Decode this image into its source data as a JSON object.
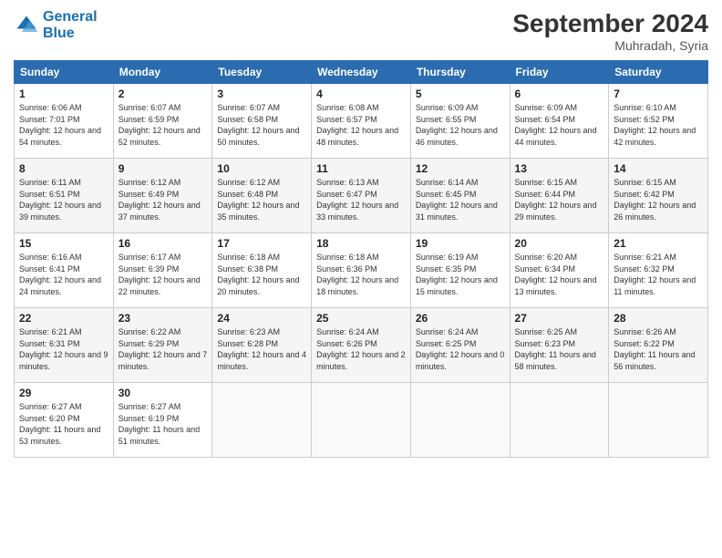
{
  "header": {
    "logo_line1": "General",
    "logo_line2": "Blue",
    "title": "September 2024",
    "subtitle": "Muhradah, Syria"
  },
  "days_of_week": [
    "Sunday",
    "Monday",
    "Tuesday",
    "Wednesday",
    "Thursday",
    "Friday",
    "Saturday"
  ],
  "weeks": [
    [
      {
        "day": "1",
        "sunrise": "6:06 AM",
        "sunset": "7:01 PM",
        "daylight": "12 hours and 54 minutes."
      },
      {
        "day": "2",
        "sunrise": "6:07 AM",
        "sunset": "6:59 PM",
        "daylight": "12 hours and 52 minutes."
      },
      {
        "day": "3",
        "sunrise": "6:07 AM",
        "sunset": "6:58 PM",
        "daylight": "12 hours and 50 minutes."
      },
      {
        "day": "4",
        "sunrise": "6:08 AM",
        "sunset": "6:57 PM",
        "daylight": "12 hours and 48 minutes."
      },
      {
        "day": "5",
        "sunrise": "6:09 AM",
        "sunset": "6:55 PM",
        "daylight": "12 hours and 46 minutes."
      },
      {
        "day": "6",
        "sunrise": "6:09 AM",
        "sunset": "6:54 PM",
        "daylight": "12 hours and 44 minutes."
      },
      {
        "day": "7",
        "sunrise": "6:10 AM",
        "sunset": "6:52 PM",
        "daylight": "12 hours and 42 minutes."
      }
    ],
    [
      {
        "day": "8",
        "sunrise": "6:11 AM",
        "sunset": "6:51 PM",
        "daylight": "12 hours and 39 minutes."
      },
      {
        "day": "9",
        "sunrise": "6:12 AM",
        "sunset": "6:49 PM",
        "daylight": "12 hours and 37 minutes."
      },
      {
        "day": "10",
        "sunrise": "6:12 AM",
        "sunset": "6:48 PM",
        "daylight": "12 hours and 35 minutes."
      },
      {
        "day": "11",
        "sunrise": "6:13 AM",
        "sunset": "6:47 PM",
        "daylight": "12 hours and 33 minutes."
      },
      {
        "day": "12",
        "sunrise": "6:14 AM",
        "sunset": "6:45 PM",
        "daylight": "12 hours and 31 minutes."
      },
      {
        "day": "13",
        "sunrise": "6:15 AM",
        "sunset": "6:44 PM",
        "daylight": "12 hours and 29 minutes."
      },
      {
        "day": "14",
        "sunrise": "6:15 AM",
        "sunset": "6:42 PM",
        "daylight": "12 hours and 26 minutes."
      }
    ],
    [
      {
        "day": "15",
        "sunrise": "6:16 AM",
        "sunset": "6:41 PM",
        "daylight": "12 hours and 24 minutes."
      },
      {
        "day": "16",
        "sunrise": "6:17 AM",
        "sunset": "6:39 PM",
        "daylight": "12 hours and 22 minutes."
      },
      {
        "day": "17",
        "sunrise": "6:18 AM",
        "sunset": "6:38 PM",
        "daylight": "12 hours and 20 minutes."
      },
      {
        "day": "18",
        "sunrise": "6:18 AM",
        "sunset": "6:36 PM",
        "daylight": "12 hours and 18 minutes."
      },
      {
        "day": "19",
        "sunrise": "6:19 AM",
        "sunset": "6:35 PM",
        "daylight": "12 hours and 15 minutes."
      },
      {
        "day": "20",
        "sunrise": "6:20 AM",
        "sunset": "6:34 PM",
        "daylight": "12 hours and 13 minutes."
      },
      {
        "day": "21",
        "sunrise": "6:21 AM",
        "sunset": "6:32 PM",
        "daylight": "12 hours and 11 minutes."
      }
    ],
    [
      {
        "day": "22",
        "sunrise": "6:21 AM",
        "sunset": "6:31 PM",
        "daylight": "12 hours and 9 minutes."
      },
      {
        "day": "23",
        "sunrise": "6:22 AM",
        "sunset": "6:29 PM",
        "daylight": "12 hours and 7 minutes."
      },
      {
        "day": "24",
        "sunrise": "6:23 AM",
        "sunset": "6:28 PM",
        "daylight": "12 hours and 4 minutes."
      },
      {
        "day": "25",
        "sunrise": "6:24 AM",
        "sunset": "6:26 PM",
        "daylight": "12 hours and 2 minutes."
      },
      {
        "day": "26",
        "sunrise": "6:24 AM",
        "sunset": "6:25 PM",
        "daylight": "12 hours and 0 minutes."
      },
      {
        "day": "27",
        "sunrise": "6:25 AM",
        "sunset": "6:23 PM",
        "daylight": "11 hours and 58 minutes."
      },
      {
        "day": "28",
        "sunrise": "6:26 AM",
        "sunset": "6:22 PM",
        "daylight": "11 hours and 56 minutes."
      }
    ],
    [
      {
        "day": "29",
        "sunrise": "6:27 AM",
        "sunset": "6:20 PM",
        "daylight": "11 hours and 53 minutes."
      },
      {
        "day": "30",
        "sunrise": "6:27 AM",
        "sunset": "6:19 PM",
        "daylight": "11 hours and 51 minutes."
      },
      null,
      null,
      null,
      null,
      null
    ]
  ]
}
